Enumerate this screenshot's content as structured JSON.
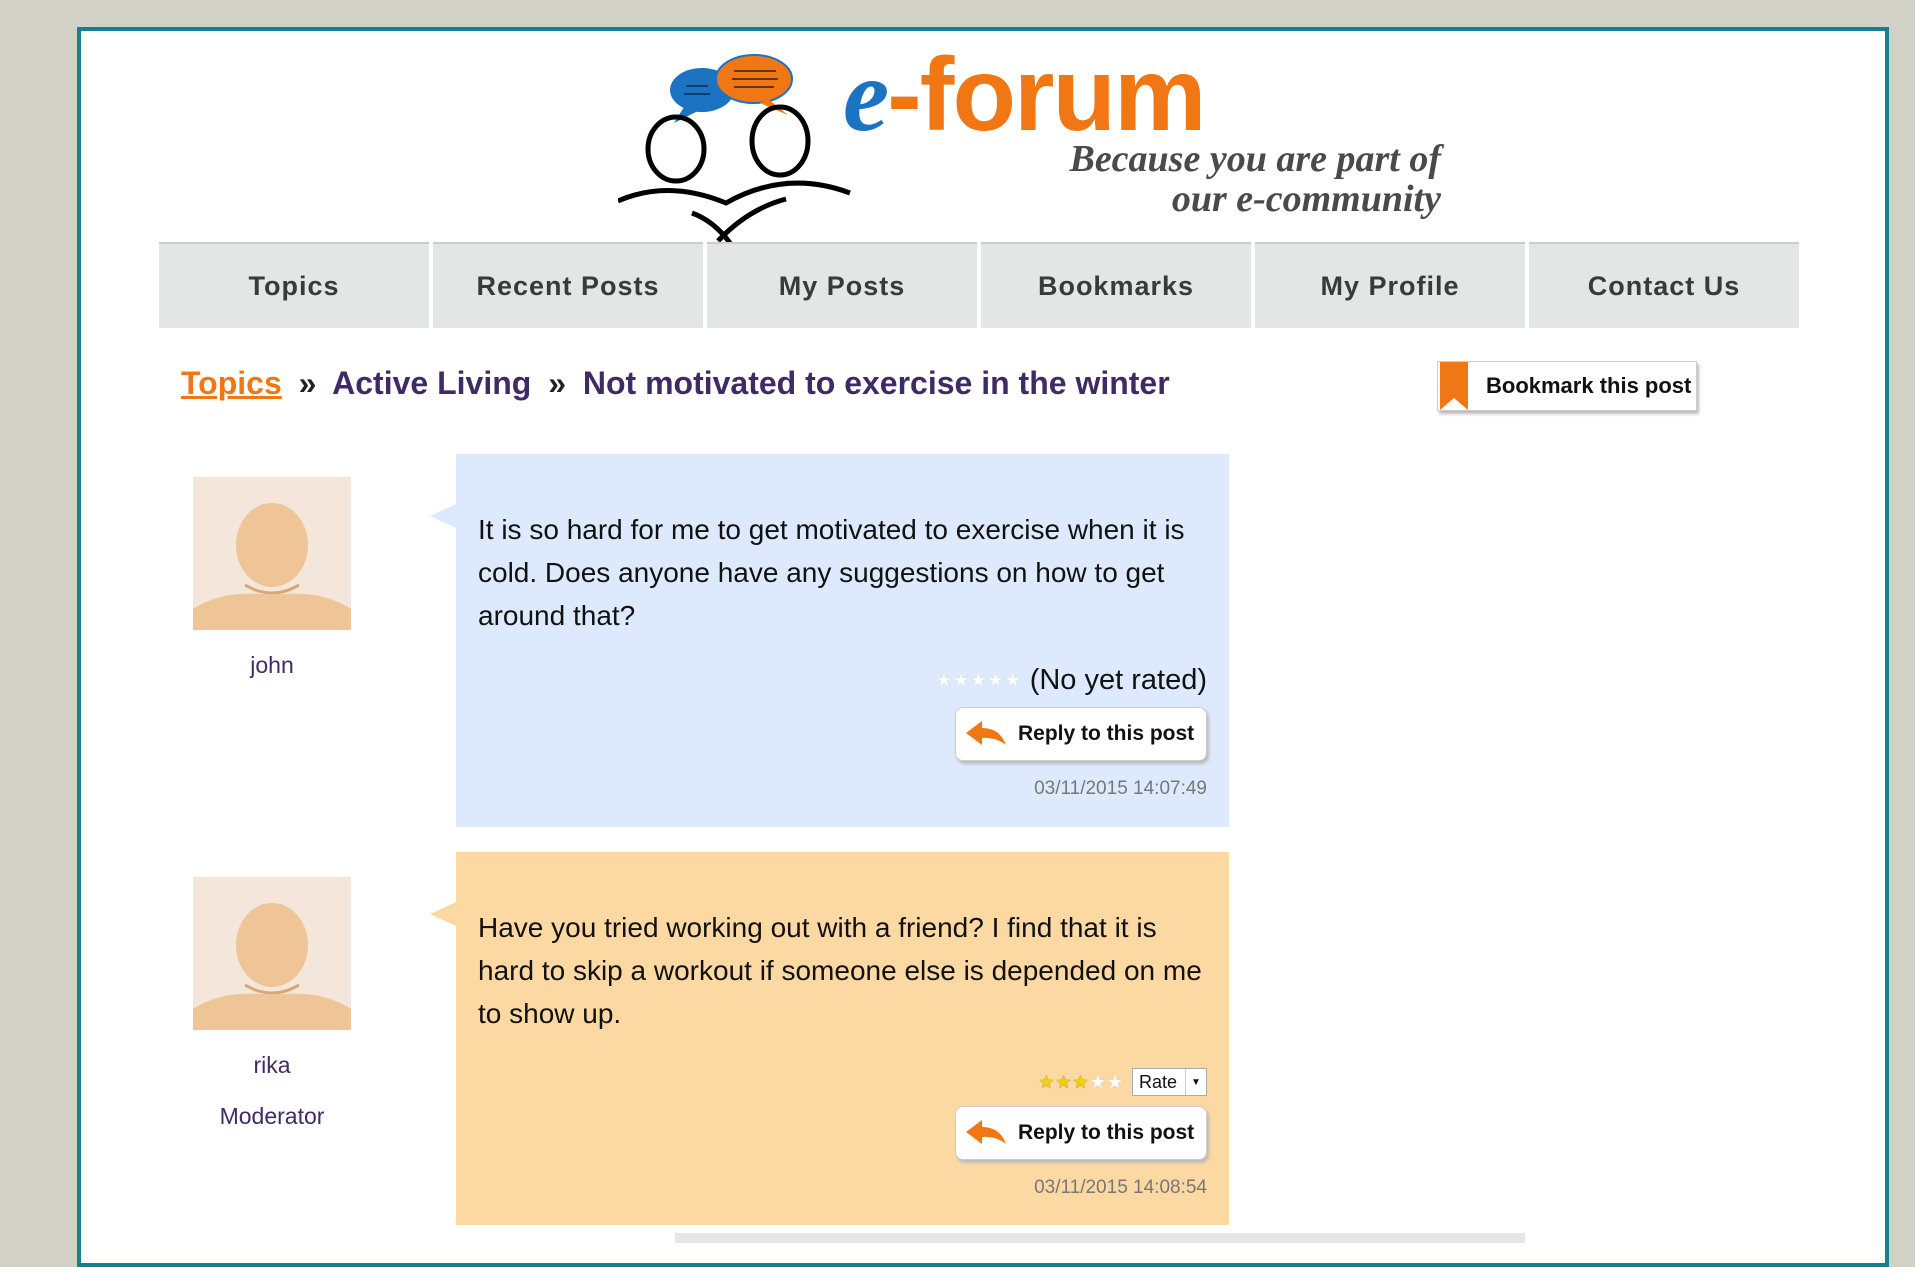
{
  "logo": {
    "e": "e",
    "rest": "-forum",
    "tagline_line1": "Because you are part of",
    "tagline_line2": "our e-community"
  },
  "nav": {
    "items": [
      {
        "label": "Topics"
      },
      {
        "label": "Recent Posts"
      },
      {
        "label": "My Posts"
      },
      {
        "label": "Bookmarks"
      },
      {
        "label": "My Profile"
      },
      {
        "label": "Contact Us"
      }
    ]
  },
  "breadcrumb": {
    "root": "Topics",
    "separator": "»",
    "category": "Active Living",
    "title": "Not motivated to exercise in the winter"
  },
  "bookmark": {
    "label": "Bookmark this post"
  },
  "posts": [
    {
      "author": "john",
      "role": "",
      "text": "It is so hard for me to get motivated to exercise when it is cold. Does anyone have any suggestions on how to get around that?",
      "rating_stars": 0,
      "rating_text": "(No yet rated)",
      "reply_label": "Reply to this post",
      "timestamp": "03/11/2015 14:07:49"
    },
    {
      "author": "rika",
      "role": "Moderator",
      "text": "Have you tried working out with a friend? I find that it is hard to skip a workout if someone else is depended on me to show up.",
      "rating_stars": 3,
      "rate_label": "Rate",
      "reply_label": "Reply to this post",
      "timestamp": "03/11/2015 14:08:54"
    }
  ],
  "colors": {
    "accent_orange": "#f07714",
    "logo_blue": "#1c73c2",
    "frame_teal": "#15808f",
    "bubble_blue": "#ddeafd",
    "bubble_orange": "#fcd9a3",
    "breadcrumb_purple": "#3f2a66"
  }
}
